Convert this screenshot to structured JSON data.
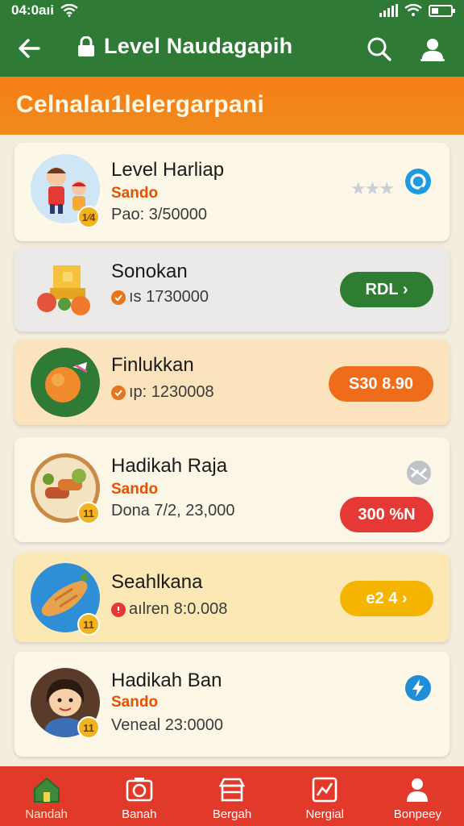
{
  "status_bar": {
    "time": "04:0aıi"
  },
  "header": {
    "title": "Level Naudagapih"
  },
  "banner": {
    "text": "Celnalaı1lelergarpani"
  },
  "items": [
    {
      "name": "Level Harliap",
      "subtitle": "Sando",
      "price": "Pao: 3/50000",
      "badge": "1⁄4",
      "status": "★★★",
      "action_icon": "chat-bubble-icon"
    },
    {
      "name": "Sonokan",
      "price": "ıs 1730000",
      "action": "RDL  ›",
      "action_color": "#2e7d32"
    },
    {
      "name": "Finlukkan",
      "price": "ıp: 1230008",
      "action": "S30 8.90",
      "action_color": "#ef6c1a"
    },
    {
      "name": "Hadikah Raja",
      "subtitle": "Sando",
      "price": "Dona 7/2, 23,000",
      "badge": "11",
      "action": "300 %N",
      "action_color": "#e53935",
      "action_icon": "broken-link-icon"
    },
    {
      "name": "Seahlkana",
      "price": "aılren  8:0.008",
      "badge": "11",
      "action": "e2 4  ›",
      "action_color": "#f4b400"
    },
    {
      "name": "Hadikah Ban",
      "subtitle": "Sando",
      "price": "Veneal  23:0000",
      "badge": "11",
      "action_icon": "flash-icon"
    }
  ],
  "bottom_nav": [
    {
      "label": "Nandah",
      "icon": "home-icon",
      "active": true
    },
    {
      "label": "Banah",
      "icon": "camera-icon"
    },
    {
      "label": "Bergah",
      "icon": "store-icon"
    },
    {
      "label": "Nergial",
      "icon": "stats-icon"
    },
    {
      "label": "Bonpeey",
      "icon": "person-icon"
    }
  ],
  "colors": {
    "header": "#2f7a34",
    "banner": "#f57f17",
    "bottom_nav": "#e13a2b"
  }
}
